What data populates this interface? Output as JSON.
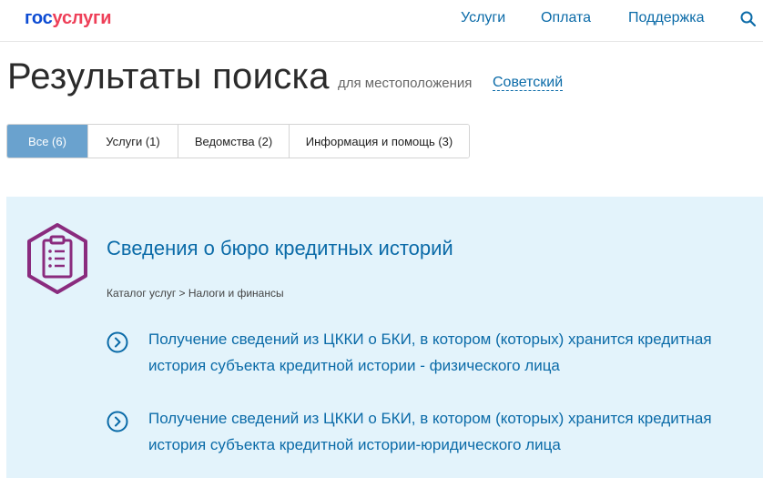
{
  "header": {
    "logo_part1": "гос",
    "logo_part2": "услуги",
    "nav": {
      "services": "Услуги",
      "payment": "Оплата",
      "support": "Поддержка"
    },
    "search_icon": "search-icon"
  },
  "title": {
    "main": "Результаты поиска",
    "location_caption": "для местоположения",
    "location_value": "Советский"
  },
  "tabs": [
    {
      "label": "Все (6)",
      "active": true
    },
    {
      "label": "Услуги (1)",
      "active": false
    },
    {
      "label": "Ведомства (2)",
      "active": false
    },
    {
      "label": "Информация и помощь (3)",
      "active": false
    }
  ],
  "result": {
    "title": "Сведения о бюро кредитных историй",
    "breadcrumb": "Каталог услуг > Налоги и финансы",
    "icon": "clipboard-list-icon",
    "items": [
      {
        "text": "Получение сведений из ЦККИ о БКИ, в котором (которых) хранится кредитная история субъекта кредитной истории - физического лица"
      },
      {
        "text": "Получение сведений из ЦККИ о БКИ, в котором (которых) хранится кредитная история субъекта кредитной истории-юридического лица"
      }
    ]
  },
  "colors": {
    "link": "#0b6ba8",
    "tab_active": "#6aa2ce",
    "card_bg": "#e3f3fb",
    "icon_accent": "#8a2b7e",
    "logo_blue": "#0d4cd3",
    "logo_red": "#ee3f58"
  }
}
